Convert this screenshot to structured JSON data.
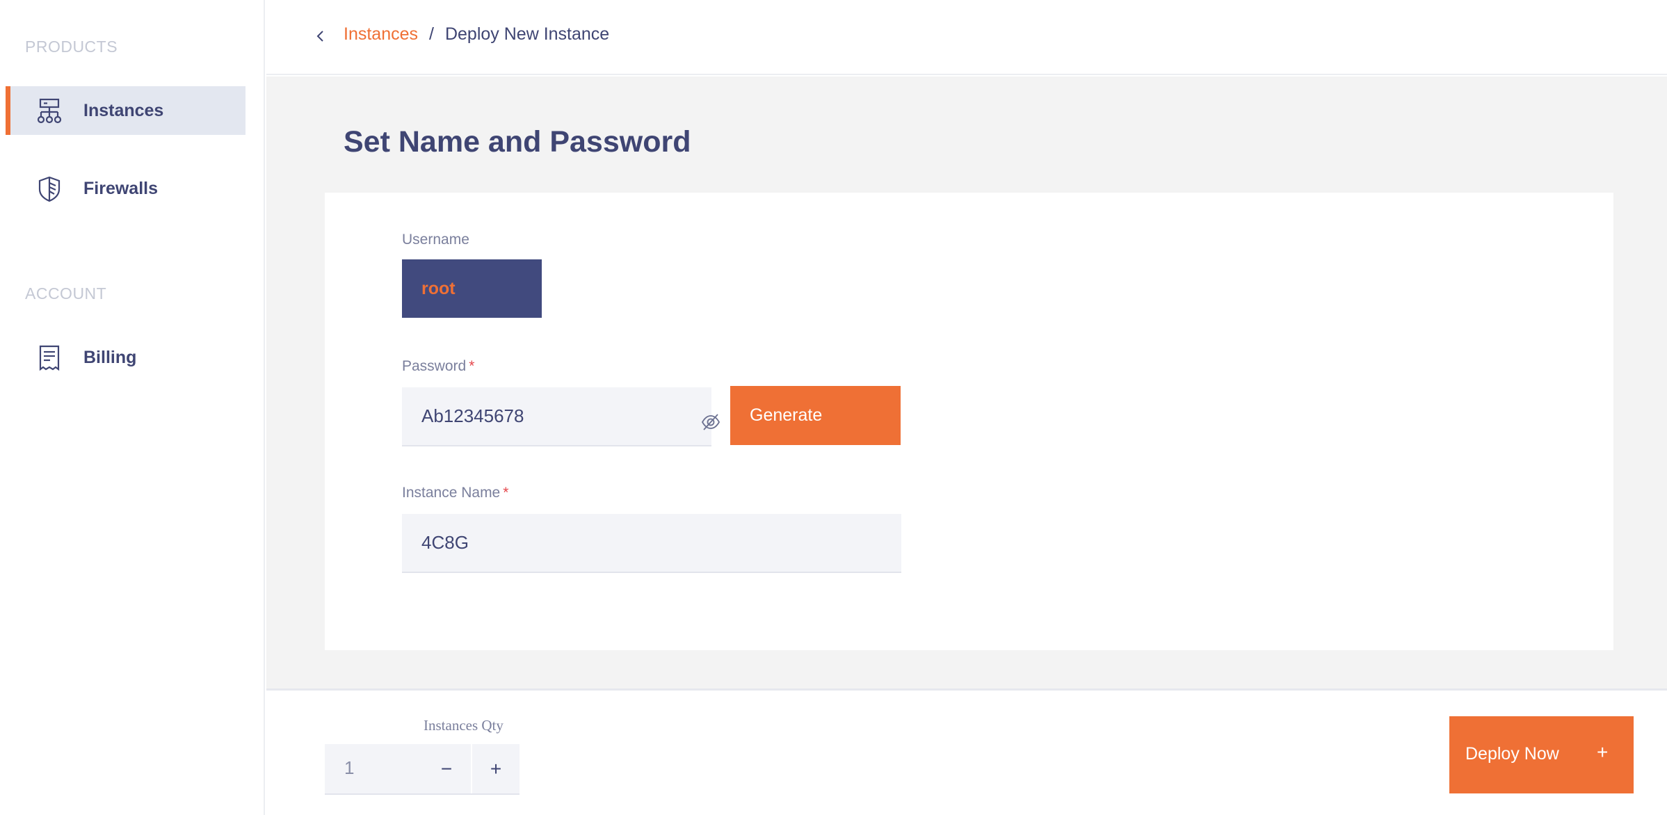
{
  "sidebar": {
    "products_label": "PRODUCTS",
    "account_label": "ACCOUNT",
    "items": [
      {
        "label": "Instances",
        "icon": "instances-icon",
        "active": true
      },
      {
        "label": "Firewalls",
        "icon": "shield-icon",
        "active": false
      },
      {
        "label": "Billing",
        "icon": "receipt-icon",
        "active": false
      }
    ]
  },
  "header": {
    "breadcrumb_parent": "Instances",
    "breadcrumb_separator": "/",
    "breadcrumb_current": "Deploy New Instance"
  },
  "main": {
    "title": "Set Name and Password",
    "username_label": "Username",
    "username_value": "root",
    "password_label": "Password",
    "password_required": "*",
    "password_value": "Ab12345678",
    "generate_label": "Generate",
    "instance_name_label": "Instance Name",
    "instance_name_required": "*",
    "instance_name_value": "4C8G"
  },
  "footer": {
    "qty_label": "Instances Qty",
    "qty_value": "1",
    "minus": "−",
    "plus": "+",
    "deploy_label": "Deploy Now",
    "deploy_icon": "+"
  },
  "colors": {
    "accent": "#ef7035",
    "navy": "#414a7e",
    "text": "#3f4573",
    "required": "#e5484d"
  }
}
